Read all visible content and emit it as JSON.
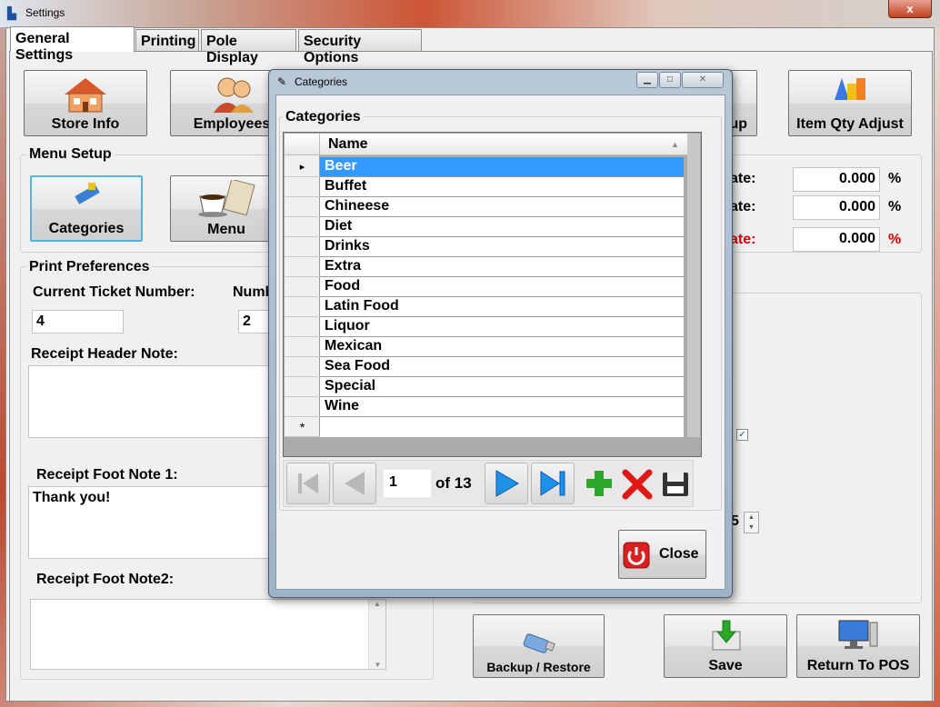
{
  "window": {
    "title": "Settings",
    "close": "x"
  },
  "tabs": [
    "General Settings",
    "Printing",
    "Pole Display",
    "Security Options"
  ],
  "top_buttons": {
    "store_info": "Store Info",
    "employees": "Employees",
    "backup_partial": "up",
    "item_qty_adjust": "Item Qty Adjust"
  },
  "menu_setup": {
    "title": "Menu Setup",
    "categories": "Categories",
    "menu": "Menu"
  },
  "tax": {
    "labels": [
      "ate:",
      "ate:",
      "ate:"
    ],
    "values": [
      "0.000",
      "0.000",
      "0.000"
    ],
    "unit": "%"
  },
  "print_prefs": {
    "title": "Print Preferences",
    "ticket_label": "Current Ticket Number:",
    "ticket_value": "4",
    "num_label": "Numb",
    "num_value": "2",
    "header_note_label": "Receipt Header Note:",
    "header_note": "",
    "foot1_label": "Receipt Foot Note 1:",
    "foot1": "Thank you!",
    "foot2_label": "Receipt Foot Note2:",
    "foot2": ""
  },
  "spinner_partial": "5",
  "bottom_buttons": {
    "backup": "Backup / Restore",
    "save": "Save",
    "return": "Return To POS"
  },
  "dialog": {
    "title": "Categories",
    "group_title": "Categories",
    "column": "Name",
    "rows": [
      "Beer",
      "Buffet",
      "Chineese",
      "Diet",
      "Drinks",
      "Extra",
      "Food",
      "Latin Food",
      "Liquor",
      "Mexican",
      "Sea Food",
      "Special",
      "Wine"
    ],
    "new_row_marker": "*",
    "current_marker": "▸",
    "nav_position": "1",
    "nav_of": "of 13",
    "close": "Close"
  },
  "colors": {
    "accent": "#3399ff",
    "red": "#e00000",
    "green": "#2aa82a"
  }
}
